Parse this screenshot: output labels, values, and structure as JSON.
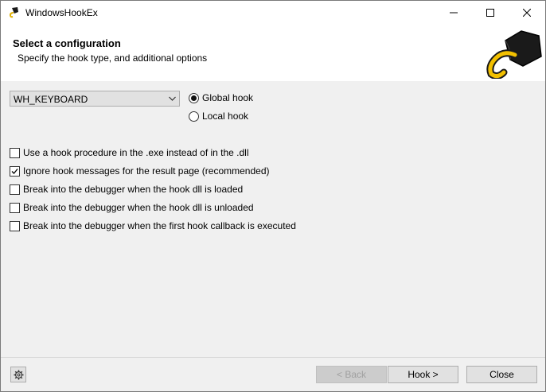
{
  "window": {
    "title": "WindowsHookEx",
    "minimize_icon": "minimize-icon",
    "maximize_icon": "maximize-icon",
    "close_icon": "close-icon"
  },
  "header": {
    "title": "Select a configuration",
    "subtitle": "Specify the hook type, and additional options",
    "logo_icon": "hook-logo-icon"
  },
  "hook_type": {
    "selected": "WH_KEYBOARD"
  },
  "scope": {
    "options": [
      {
        "label": "Global hook",
        "checked": true
      },
      {
        "label": "Local hook",
        "checked": false
      }
    ]
  },
  "options": [
    {
      "label": "Use a hook procedure in the .exe instead of in the .dll",
      "checked": false
    },
    {
      "label": "Ignore hook messages for the result page (recommended)",
      "checked": true
    },
    {
      "label": "Break into the debugger when the hook dll is loaded",
      "checked": false
    },
    {
      "label": "Break into the debugger when the hook dll is unloaded",
      "checked": false
    },
    {
      "label": "Break into the debugger when the first hook callback is executed",
      "checked": false
    }
  ],
  "footer": {
    "settings_icon": "gear-icon",
    "back_label": "< Back",
    "hook_label": "Hook >",
    "close_label": "Close"
  }
}
